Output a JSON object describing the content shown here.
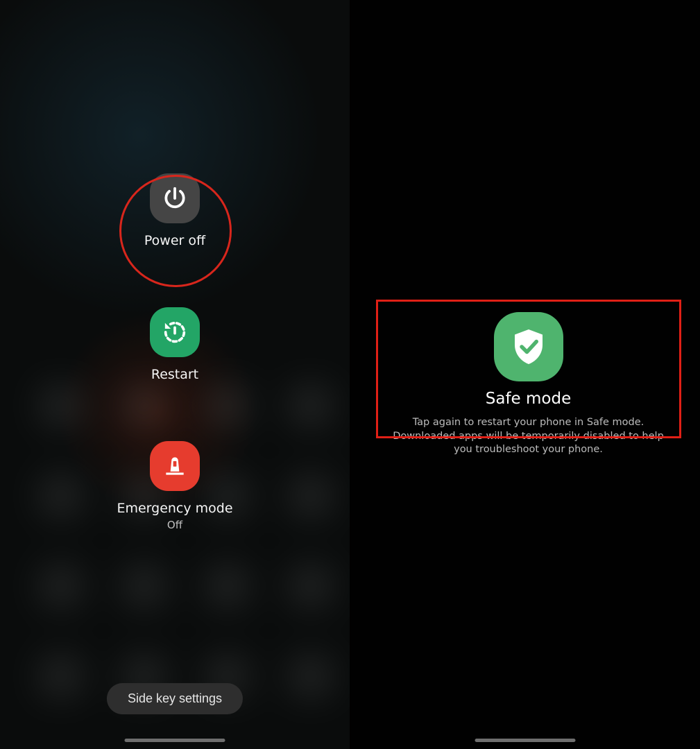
{
  "left": {
    "poweroff": {
      "label": "Power off"
    },
    "restart": {
      "label": "Restart"
    },
    "emergency": {
      "label": "Emergency mode",
      "state": "Off"
    },
    "sidekey": {
      "label": "Side key settings"
    }
  },
  "right": {
    "safe": {
      "title": "Safe mode",
      "desc": "Tap again to restart your phone in Safe mode. Downloaded apps will be temporarily disabled to help you troubleshoot your phone."
    }
  },
  "annotations": {
    "circle_color": "#d8261c",
    "rect_color": "#e02016"
  }
}
